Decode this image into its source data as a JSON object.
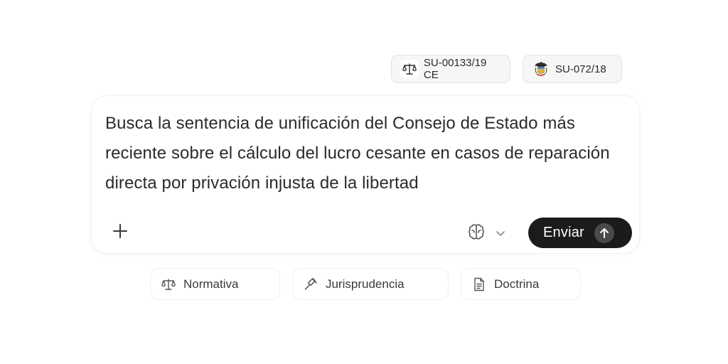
{
  "context_chips": [
    {
      "label": "SU-00133/19 CE",
      "icon": "scales-icon"
    },
    {
      "label": "SU-072/18",
      "icon": "coat-of-arms-icon"
    }
  ],
  "composer": {
    "prompt_text": "Busca la sentencia de unificación del Consejo de Estado más reciente sobre el cálculo del lucro cesante en casos de reparación directa por privación injusta de la libertad",
    "send_label": "Enviar",
    "model_icon": "brain-icon"
  },
  "quick_actions": [
    {
      "label": "Normativa",
      "icon": "scales-icon"
    },
    {
      "label": "Jurisprudencia",
      "icon": "gavel-icon"
    },
    {
      "label": "Doctrina",
      "icon": "document-icon"
    }
  ],
  "colors": {
    "send_button_bg": "#1b1b1b",
    "chip_bg": "#f6f6f6",
    "text": "#2b2b2b"
  }
}
